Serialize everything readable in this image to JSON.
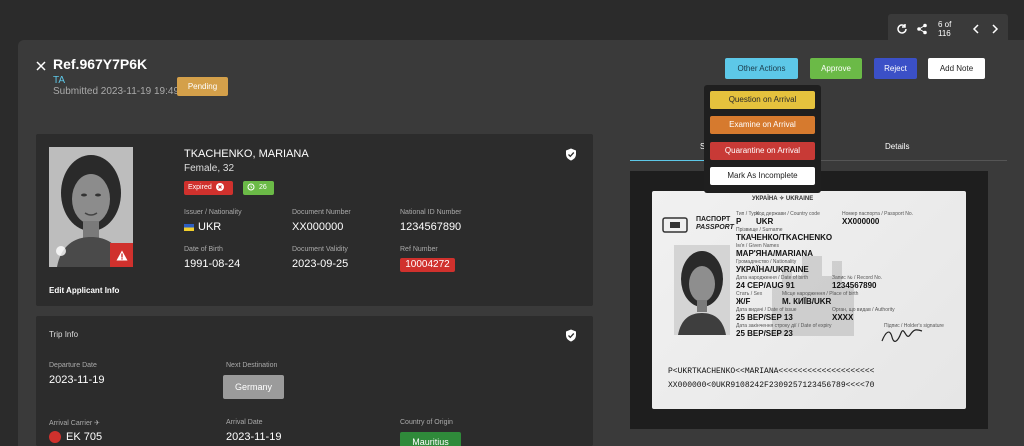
{
  "topbar": {
    "counter": "6 of 116"
  },
  "header": {
    "ref": "Ref.967Y7P6K",
    "type": "TA",
    "submitted": "Submitted 2023-11-19 19:49",
    "status": "Pending"
  },
  "actions": {
    "other": "Other Actions",
    "approve": "Approve",
    "reject": "Reject",
    "add_note": "Add Note"
  },
  "dropdown": {
    "question": "Question on Arrival",
    "examine": "Examine on Arrival",
    "quarantine": "Quarantine on Arrival",
    "incomplete": "Mark As Incomplete"
  },
  "applicant": {
    "name": "TKACHENKO, MARIANA",
    "gender_age": "Female, 32",
    "expired": "Expired",
    "days": "26",
    "issuer_label": "Issuer / Nationality",
    "issuer": "UKR",
    "doc_label": "Document Number",
    "doc": "XX000000",
    "national_label": "National ID Number",
    "national": "1234567890",
    "dob_label": "Date of Birth",
    "dob": "1991-08-24",
    "validity_label": "Document Validity",
    "validity": "2023-09-25",
    "refnum_label": "Ref Number",
    "refnum": "10004272",
    "edit": "Edit Applicant Info"
  },
  "trip": {
    "title": "Trip Info",
    "departure_label": "Departure Date",
    "departure": "2023-11-19",
    "next_label": "Next Destination",
    "next": "Germany",
    "carrier_label": "Arrival Carrier",
    "carrier": "EK 705",
    "arrival_label": "Arrival Date",
    "arrival": "2023-11-19",
    "origin_label": "Country of Origin",
    "origin": "Mauritius"
  },
  "tabs": {
    "details": "Details",
    "scan": "S"
  },
  "passport": {
    "header": "УКРАЇНА ✧ UKRAINE",
    "title_ua": "ПАСПОРТ",
    "title_en": "PASSPORT",
    "type_label": "Тип / Type",
    "type": "P",
    "country_label": "Код держави / Country code",
    "country": "UKR",
    "passno_label": "Номер паспорта / Passport No.",
    "passno": "XX000000",
    "surname_label": "Прізвище / Surname",
    "surname": "ТКАЧЕНКО/TKACHENKO",
    "given_label": "Ім'я / Given Names",
    "given": "МАР'ЯНА/MARIANA",
    "nat_label": "Громадянство / Nationality",
    "nat": "УКРАЇНА/UKRAINE",
    "dob_label": "Дата народження / Date of birth",
    "dob": "24 СЕР/AUG 91",
    "rec_label": "Запис № / Record No.",
    "rec": "1234567890",
    "sex_label": "Стать / Sex",
    "sex": "Ж/F",
    "pob_label": "Місце народження / Place of birth",
    "pob": "М. КИЇВ/UKR",
    "issue_label": "Дата видачі / Date of issue",
    "issue": "25 ВЕР/SEP 13",
    "auth_label": "Орган, що видав / Authority",
    "auth": "XXXX",
    "expiry_label": "Дата закінчення строку дії / Date of expiry",
    "expiry": "25 ВЕР/SEP 23",
    "holder_label": "Підпис / Holder's signature",
    "mrz1": "P<UKRTKACHENKO<<MARIANA<<<<<<<<<<<<<<<<<<<<",
    "mrz2": "XX000000<0UKR9108242F2309257123456789<<<<70"
  }
}
